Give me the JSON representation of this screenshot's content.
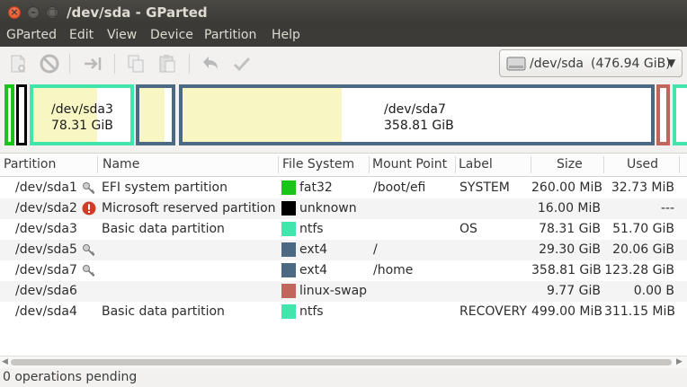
{
  "window": {
    "title": "/dev/sda - GParted"
  },
  "menu": [
    "GParted",
    "Edit",
    "View",
    "Device",
    "Partition",
    "Help"
  ],
  "toolbar": {
    "icons": [
      "new-partition-icon",
      "delete-icon",
      "resize-move-icon",
      "copy-icon",
      "paste-icon",
      "undo-icon",
      "apply-icon"
    ],
    "device_name": "/dev/sda",
    "device_size": "(476.94 GiB)"
  },
  "diskmap": {
    "sda3": {
      "name": "/dev/sda3",
      "size": "78.31 GiB",
      "used_fraction": 0.66
    },
    "sda7": {
      "name": "/dev/sda7",
      "size": "358.81 GiB",
      "used_fraction": 0.34
    }
  },
  "table": {
    "headers": [
      "Partition",
      "Name",
      "File System",
      "Mount Point",
      "Label",
      "Size",
      "Used"
    ],
    "rows": [
      {
        "partition": "/dev/sda1",
        "icon": "key-icon",
        "name": "EFI system partition",
        "fs": "fat32",
        "fs_color": "#1ac41a",
        "mount": "/boot/efi",
        "label": "SYSTEM",
        "size": "260.00 MiB",
        "used": "32.73 MiB"
      },
      {
        "partition": "/dev/sda2",
        "icon": "error-icon",
        "name": "Microsoft reserved partition",
        "fs": "unknown",
        "fs_color": "#000000",
        "mount": "",
        "label": "",
        "size": "16.00 MiB",
        "used": "---"
      },
      {
        "partition": "/dev/sda3",
        "icon": "",
        "name": "Basic data partition",
        "fs": "ntfs",
        "fs_color": "#42e5ac",
        "mount": "",
        "label": "OS",
        "size": "78.31 GiB",
        "used": "51.70 GiB"
      },
      {
        "partition": "/dev/sda5",
        "icon": "key-icon",
        "name": "",
        "fs": "ext4",
        "fs_color": "#4b6983",
        "mount": "/",
        "label": "",
        "size": "29.30 GiB",
        "used": "20.06 GiB"
      },
      {
        "partition": "/dev/sda7",
        "icon": "key-icon",
        "name": "",
        "fs": "ext4",
        "fs_color": "#4b6983",
        "mount": "/home",
        "label": "",
        "size": "358.81 GiB",
        "used": "123.28 GiB"
      },
      {
        "partition": "/dev/sda6",
        "icon": "",
        "name": "",
        "fs": "linux-swap",
        "fs_color": "#c1665a",
        "mount": "",
        "label": "",
        "size": "9.77 GiB",
        "used": "0.00 B"
      },
      {
        "partition": "/dev/sda4",
        "icon": "",
        "name": "Basic data partition",
        "fs": "ntfs",
        "fs_color": "#42e5ac",
        "mount": "",
        "label": "RECOVERY",
        "size": "499.00 MiB",
        "used": "311.15 MiB"
      }
    ]
  },
  "status": {
    "text": "0 operations pending"
  }
}
